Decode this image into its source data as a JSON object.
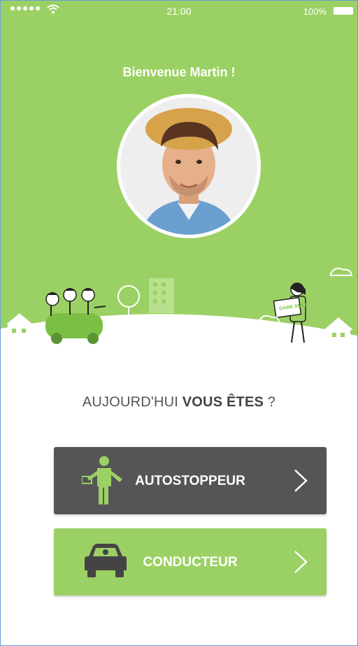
{
  "status_bar": {
    "time": "21:00",
    "battery": "100%"
  },
  "welcome": "Bienvenue Martin !",
  "question": {
    "prefix": "AUJOURD'HUI ",
    "bold": "VOUS ÊTES",
    "suffix": " ?"
  },
  "options": [
    {
      "label": "AUTOSTOPPEUR",
      "icon": "hitchhiker-icon",
      "color": "#555557"
    },
    {
      "label": "CONDUCTEUR",
      "icon": "car-icon",
      "color": "#9bd164"
    }
  ],
  "colors": {
    "brand_green": "#9bd164",
    "dark_gray": "#555557"
  },
  "illustration": {
    "sign_text": "GARE SNCF"
  }
}
